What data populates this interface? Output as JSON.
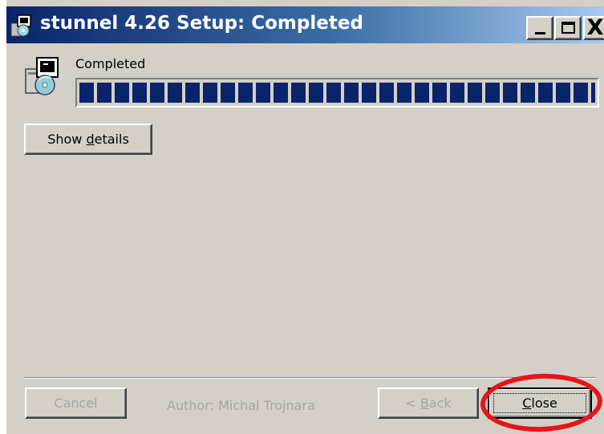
{
  "window": {
    "title": "stunnel 4.26 Setup: Completed",
    "close_glyph": "X"
  },
  "status": {
    "label": "Completed",
    "progress_percent": 100
  },
  "buttons": {
    "show_details_prefix": "Show ",
    "show_details_accel": "d",
    "show_details_suffix": "etails",
    "cancel": "Cancel",
    "back_prefix": "< ",
    "back_accel": "B",
    "back_suffix": "ack",
    "close_accel": "C",
    "close_suffix": "lose"
  },
  "footer": {
    "author": "Author: Michal Trojnara"
  },
  "colors": {
    "titlebar_start": "#0a246a",
    "titlebar_end": "#a6caf0",
    "progress_block": "#0a246a",
    "face": "#d4d0c8",
    "highlight_ring": "#e8141a"
  },
  "icons": {
    "title": "installer-icon",
    "content": "installer-icon"
  }
}
